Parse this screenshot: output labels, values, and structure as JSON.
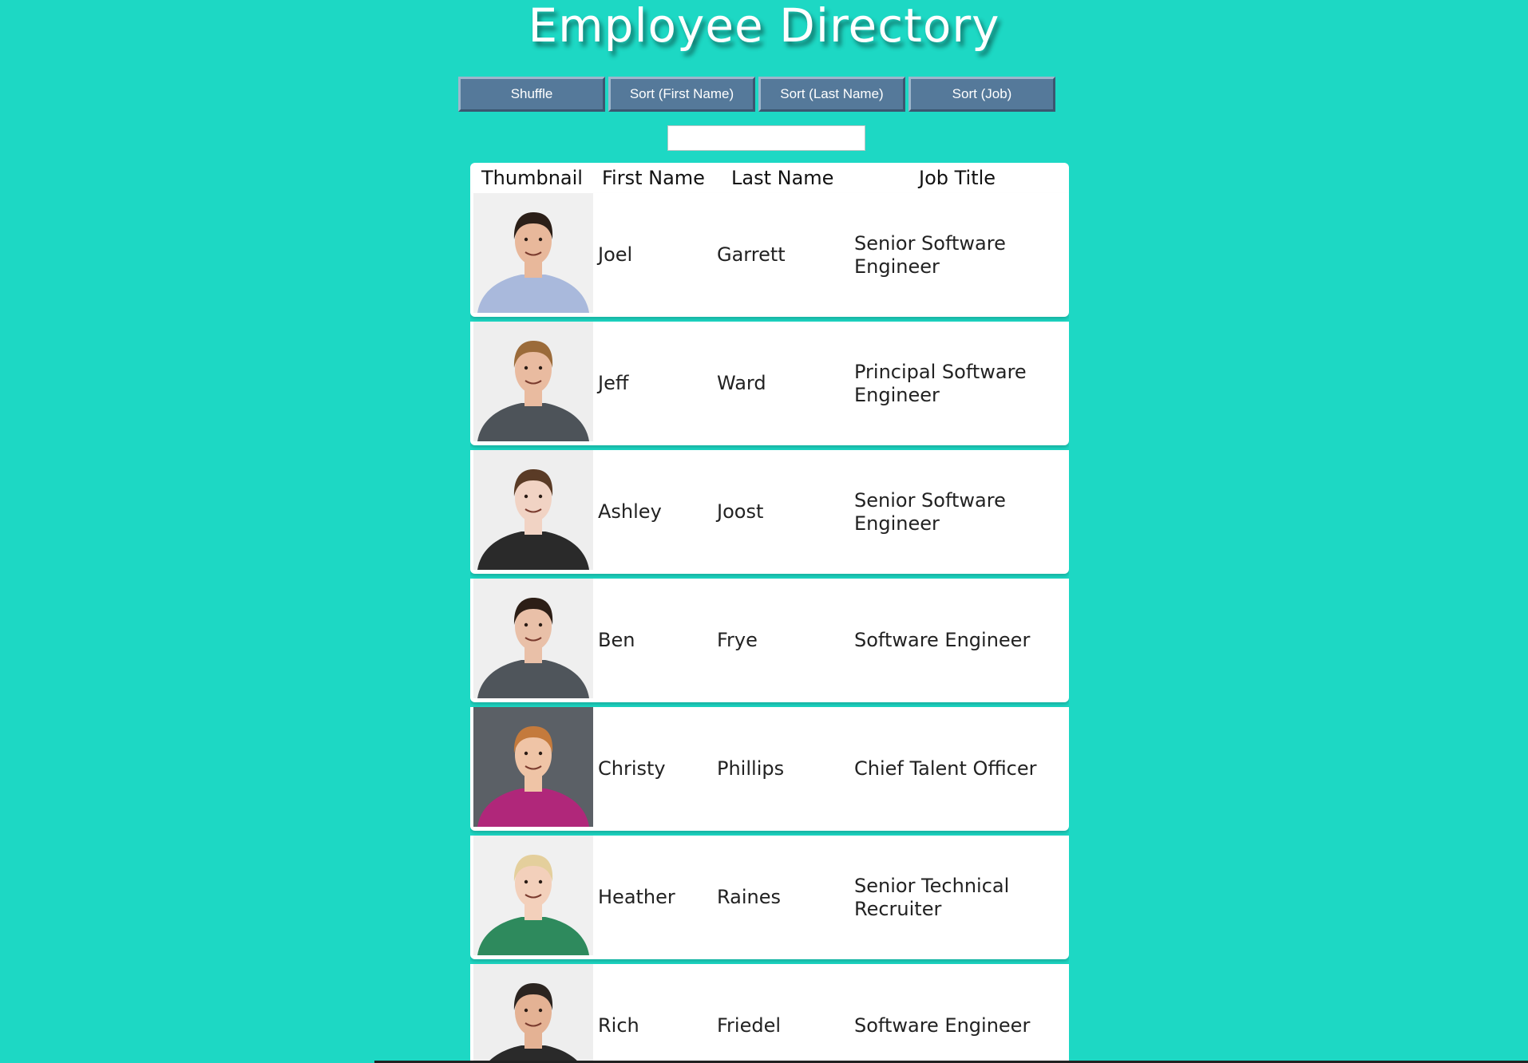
{
  "title": "Employee Directory",
  "toolbar": {
    "shuffle": "Shuffle",
    "sort_first": "Sort (First Name)",
    "sort_last": "Sort (Last Name)",
    "sort_job": "Sort (Job)"
  },
  "search": {
    "value": ""
  },
  "table": {
    "headers": {
      "thumbnail": "Thumbnail",
      "first": "First Name",
      "last": "Last Name",
      "job": "Job Title"
    },
    "rows": [
      {
        "first": "Joel",
        "last": "Garrett",
        "job": "Senior Software Engineer",
        "photo_bg": "#f0f0f0",
        "shirt": "#a9b9dc",
        "hair": "#2b1f18",
        "skin": "#e8b89b"
      },
      {
        "first": "Jeff",
        "last": "Ward",
        "job": "Principal Software Engineer",
        "photo_bg": "#eeeeee",
        "shirt": "#4d5359",
        "hair": "#9b6b3a",
        "skin": "#e9bba0"
      },
      {
        "first": "Ashley",
        "last": "Joost",
        "job": "Senior Software Engineer",
        "photo_bg": "#eeeeee",
        "shirt": "#2a2a2a",
        "hair": "#5a3b26",
        "skin": "#f1d3c4"
      },
      {
        "first": "Ben",
        "last": "Frye",
        "job": "Software Engineer",
        "photo_bg": "#efefef",
        "shirt": "#4f555b",
        "hair": "#2c1e16",
        "skin": "#e9c0a8"
      },
      {
        "first": "Christy",
        "last": "Phillips",
        "job": "Chief Talent Officer",
        "photo_bg": "#5b6066",
        "shirt": "#b0277a",
        "hair": "#c47a3c",
        "skin": "#efc4a6"
      },
      {
        "first": "Heather",
        "last": "Raines",
        "job": "Senior Technical Recruiter",
        "photo_bg": "#f0f0f0",
        "shirt": "#2e8a5d",
        "hair": "#e4cf9c",
        "skin": "#f3d0bb"
      },
      {
        "first": "Rich",
        "last": "Friedel",
        "job": "Software Engineer",
        "photo_bg": "#eeeeee",
        "shirt": "#2a2a2a",
        "hair": "#2b2420",
        "skin": "#e4b294"
      }
    ]
  }
}
